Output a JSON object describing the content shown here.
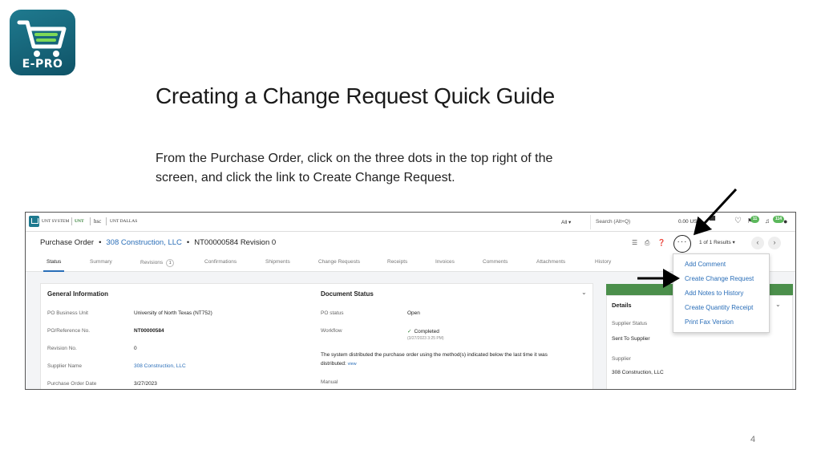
{
  "logo": {
    "text": "E-PRO",
    "icon": "shopping-cart-icon"
  },
  "slide": {
    "title": "Creating a Change Request Quick Guide",
    "body": "From the Purchase Order, click on the three dots in the top right of the screen, and click the link to Create Change Request.",
    "page_number": "4"
  },
  "screenshot": {
    "topbar": {
      "brand_1": "UNT SYSTEM",
      "brand_2": "UNT",
      "brand_3": "hsc",
      "brand_4": "UNT DALLAS",
      "scope": "All ▾",
      "search_placeholder": "Search (Alt+Q)",
      "cart_amount": "0.00 USD",
      "flag_badge": "11",
      "notif_badge": "114"
    },
    "titlebar": {
      "doc_type": "Purchase Order",
      "supplier": "308 Construction, LLC",
      "doc_number": "NT00000584 Revision 0",
      "more_button": "···",
      "results": "1 of 1 Results ▾"
    },
    "tabs": [
      {
        "label": "Status",
        "active": true
      },
      {
        "label": "Summary"
      },
      {
        "label": "Revisions",
        "count": "1"
      },
      {
        "label": "Confirmations"
      },
      {
        "label": "Shipments"
      },
      {
        "label": "Change Requests"
      },
      {
        "label": "Receipts"
      },
      {
        "label": "Invoices"
      },
      {
        "label": "Comments"
      },
      {
        "label": "Attachments"
      },
      {
        "label": "History"
      }
    ],
    "general_info": {
      "title": "General Information",
      "rows": [
        {
          "label": "PO Business Unit",
          "value": "University of North Texas (NT752)"
        },
        {
          "label": "PO/Reference No.",
          "value": "NT00000584"
        },
        {
          "label": "Revision No.",
          "value": "0"
        },
        {
          "label": "Supplier Name",
          "value": "308 Construction, LLC"
        },
        {
          "label": "Purchase Order Date",
          "value": "3/27/2023"
        }
      ]
    },
    "doc_status": {
      "title": "Document Status",
      "po_status_label": "PO status",
      "po_status_value": "Open",
      "workflow_label": "Workflow",
      "workflow_value": "Completed",
      "workflow_date": "(3/27/2023 3:25 PM)",
      "distribution_text": "The system distributed the purchase order using the method(s) indicated below the last time it was",
      "distributed_label": "distributed:",
      "view_link": "view",
      "manual_label": "Manual"
    },
    "details": {
      "title": "Details",
      "supplier_status_label": "Supplier Status",
      "supplier_status_value": "Sent To Supplier",
      "supplier_label": "Supplier",
      "supplier_value": "308 Construction, LLC"
    },
    "menu": {
      "items": [
        "Add Comment",
        "Create Change Request",
        "Add Notes to History",
        "Create Quantity Receipt",
        "Print Fax Version"
      ]
    }
  },
  "colors": {
    "link": "#2a6eb8",
    "accent_green": "#4b8f4b",
    "logo_teal": "#1f7a8f"
  }
}
